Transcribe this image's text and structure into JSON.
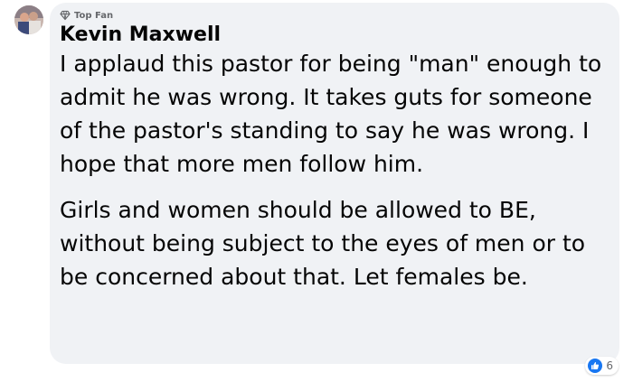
{
  "comment": {
    "badge": "Top Fan",
    "author": "Kevin Maxwell",
    "paragraphs": [
      "I applaud this pastor for being \"man\" enough to admit he was wrong. It takes guts for someone of the pastor's standing to say he was wrong. I hope that more men follow him.",
      "Girls and women should be allowed to BE, without being subject to the eyes of men or to be concerned about that. Let females be."
    ],
    "reaction_count": "6"
  },
  "icons": {
    "badge": "diamond-icon",
    "reaction": "like-icon"
  },
  "colors": {
    "bubble": "#f0f2f5",
    "like": "#1877f2",
    "meta": "#65676b"
  }
}
